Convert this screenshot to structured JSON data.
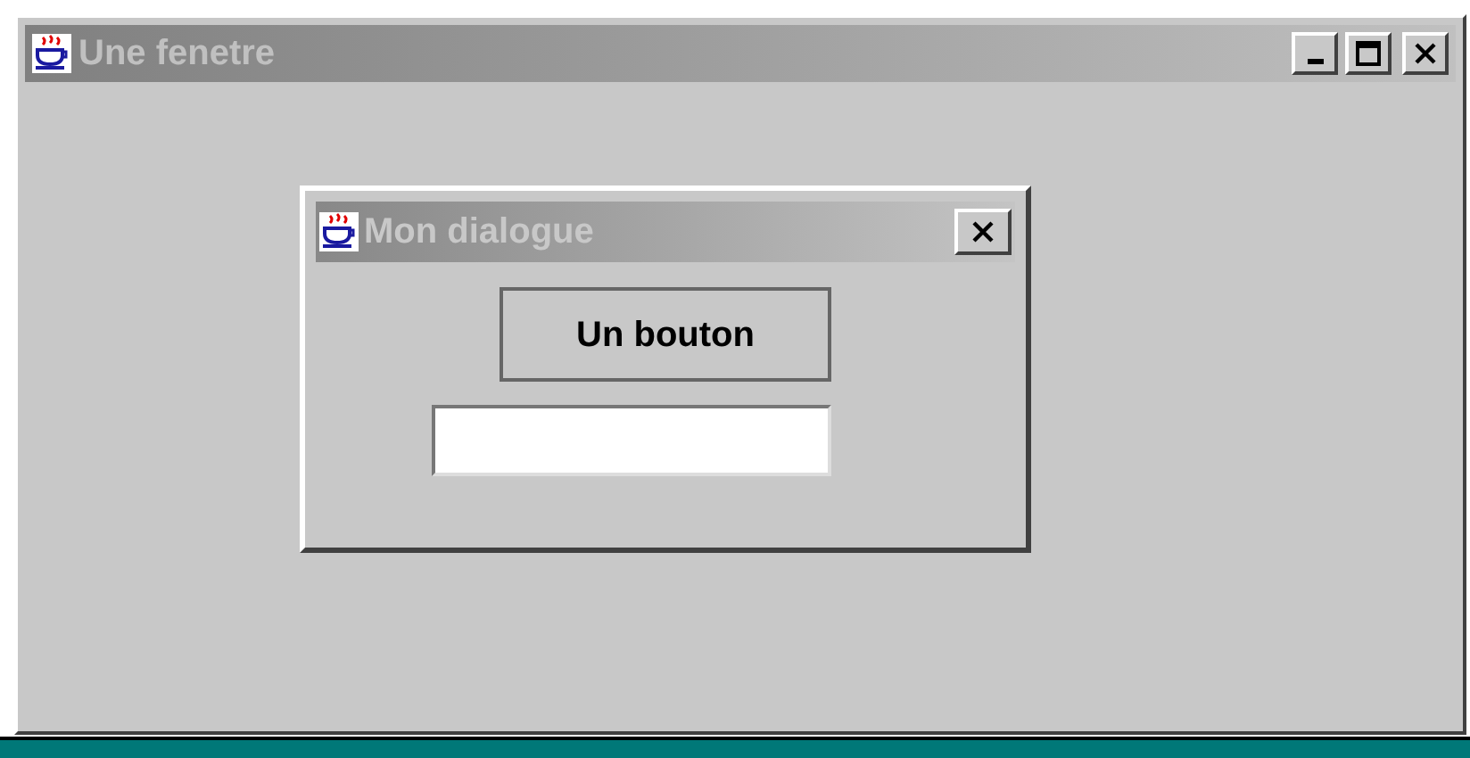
{
  "window": {
    "title": "Une fenetre"
  },
  "dialog": {
    "title": "Mon dialogue",
    "button": "Un bouton"
  }
}
